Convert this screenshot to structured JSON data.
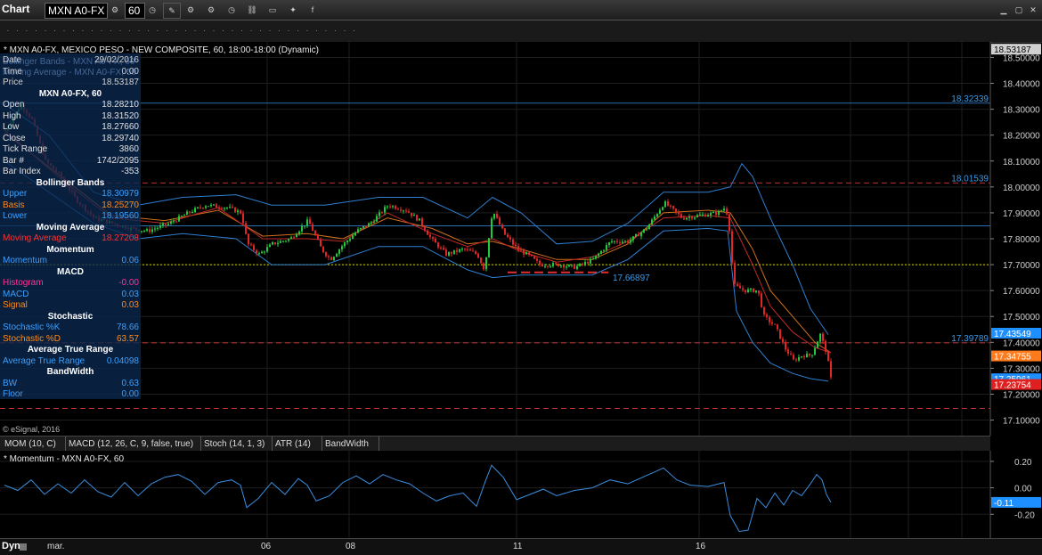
{
  "toolbar": {
    "app_title": "Chart",
    "symbol": "MXN A0-FX",
    "interval": "60",
    "icons": [
      "settings-icon",
      "clock-icon",
      "pencil-icon",
      "gear-icon",
      "gear-icon",
      "clock-icon",
      "link-icon",
      "display-icon",
      "twitter-icon",
      "facebook-icon"
    ]
  },
  "chart_header": "* MXN A0-FX, MEXICO PESO - NEW COMPOSITE, 60, 18:00-18:00 (Dynamic)",
  "copyright": "© eSignal, 2016",
  "info_panel": {
    "top_rows": [
      {
        "label": "Date",
        "value": "29/02/2016"
      },
      {
        "label": "Time",
        "value": "0:00"
      },
      {
        "label": "Price",
        "value": "18.53187"
      }
    ],
    "ghost_rows": [
      "Bollinger Bands - MXN A0-FX, 60",
      "Moving Average - MXN A0-FX, 60"
    ],
    "sections": [
      {
        "title": "MXN A0-FX, 60",
        "rows": [
          {
            "label": "Open",
            "value": "18.28210",
            "color": "#e0e0e0"
          },
          {
            "label": "High",
            "value": "18.31520",
            "color": "#e0e0e0"
          },
          {
            "label": "Low",
            "value": "18.27660",
            "color": "#e0e0e0"
          },
          {
            "label": "Close",
            "value": "18.29740",
            "color": "#e0e0e0"
          },
          {
            "label": "Tick Range",
            "value": "3860",
            "color": "#e0e0e0"
          },
          {
            "label": "Bar #",
            "value": "1742/2095",
            "color": "#e0e0e0"
          },
          {
            "label": "Bar Index",
            "value": "-353",
            "color": "#e0e0e0"
          }
        ]
      },
      {
        "title": "Bollinger Bands",
        "rows": [
          {
            "label": "Upper",
            "value": "18.30979",
            "color": "#3aa0ff"
          },
          {
            "label": "Basis",
            "value": "18.25270",
            "color": "#ff8c1a"
          },
          {
            "label": "Lower",
            "value": "18.19560",
            "color": "#3aa0ff"
          }
        ]
      },
      {
        "title": "Moving Average",
        "rows": [
          {
            "label": "Moving Average",
            "value": "18.27208",
            "color": "#ff3030"
          }
        ]
      },
      {
        "title": "Momentum",
        "rows": [
          {
            "label": "Momentum",
            "value": "0.06",
            "color": "#3aa0ff"
          }
        ]
      },
      {
        "title": "MACD",
        "rows": [
          {
            "label": "Histogram",
            "value": "-0.00",
            "color": "#ff3399"
          },
          {
            "label": "MACD",
            "value": "0.03",
            "color": "#3aa0ff"
          },
          {
            "label": "Signal",
            "value": "0.03",
            "color": "#ff8c1a"
          }
        ]
      },
      {
        "title": "Stochastic",
        "rows": [
          {
            "label": "Stochastic %K",
            "value": "78.66",
            "color": "#3aa0ff"
          },
          {
            "label": "Stochastic %D",
            "value": "63.57",
            "color": "#ff8c1a"
          }
        ]
      },
      {
        "title": "Average True Range",
        "rows": [
          {
            "label": "Average True Range",
            "value": "0.04098",
            "color": "#3aa0ff"
          }
        ]
      },
      {
        "title": "BandWidth",
        "rows": [
          {
            "label": "BW",
            "value": "0.63",
            "color": "#3aa0ff"
          },
          {
            "label": "Floor",
            "value": "0.00",
            "color": "#3aa0ff"
          }
        ]
      }
    ]
  },
  "indicator_tabs": [
    "MOM (10, C)",
    "MACD (12, 26, C, 9, false, true)",
    "Stoch (14, 1, 3)",
    "ATR (14)",
    "BandWidth"
  ],
  "momentum_header": "* Momentum - MXN A0-FX, 60",
  "bottom_bar": {
    "mode": "Dyn",
    "first_label": "mar."
  },
  "chart_data": [
    {
      "type": "candlestick",
      "title": "MXN A0-FX, MEXICO PESO - NEW COMPOSITE, 60, 18:00-18:00 (Dynamic)",
      "ylim": [
        17.04,
        18.56
      ],
      "y_ticks": [
        "18.50000",
        "18.40000",
        "18.30000",
        "18.20000",
        "18.10000",
        "18.00000",
        "17.90000",
        "17.80000",
        "17.70000",
        "17.60000",
        "17.50000",
        "17.40000",
        "17.30000",
        "17.20000",
        "17.10000"
      ],
      "x_tick_labels": [
        "06",
        "08",
        "11",
        "16"
      ],
      "grid": true,
      "legend": "none",
      "close_path": [
        [
          0,
          18.22
        ],
        [
          18,
          18.32
        ],
        [
          30,
          18.26
        ],
        [
          45,
          18.1
        ],
        [
          60,
          18.05
        ],
        [
          80,
          17.95
        ],
        [
          100,
          17.88
        ],
        [
          120,
          17.86
        ],
        [
          140,
          17.84
        ],
        [
          160,
          17.83
        ],
        [
          185,
          17.86
        ],
        [
          205,
          17.9
        ],
        [
          225,
          17.93
        ],
        [
          250,
          17.92
        ],
        [
          265,
          17.9
        ],
        [
          272,
          17.78
        ],
        [
          285,
          17.74
        ],
        [
          300,
          17.78
        ],
        [
          320,
          17.8
        ],
        [
          340,
          17.87
        ],
        [
          355,
          17.76
        ],
        [
          365,
          17.72
        ],
        [
          380,
          17.78
        ],
        [
          395,
          17.83
        ],
        [
          410,
          17.86
        ],
        [
          430,
          17.93
        ],
        [
          450,
          17.91
        ],
        [
          465,
          17.87
        ],
        [
          478,
          17.8
        ],
        [
          495,
          17.74
        ],
        [
          515,
          17.76
        ],
        [
          530,
          17.74
        ],
        [
          538,
          17.68
        ],
        [
          547,
          17.91
        ],
        [
          560,
          17.82
        ],
        [
          575,
          17.76
        ],
        [
          590,
          17.73
        ],
        [
          600,
          17.7
        ],
        [
          620,
          17.7
        ],
        [
          640,
          17.69
        ],
        [
          660,
          17.72
        ],
        [
          680,
          17.79
        ],
        [
          700,
          17.79
        ],
        [
          720,
          17.84
        ],
        [
          740,
          17.94
        ],
        [
          760,
          17.88
        ],
        [
          780,
          17.89
        ],
        [
          800,
          17.9
        ],
        [
          808,
          17.92
        ],
        [
          812,
          17.88
        ],
        [
          818,
          17.62
        ],
        [
          830,
          17.6
        ],
        [
          845,
          17.6
        ],
        [
          852,
          17.5
        ],
        [
          865,
          17.46
        ],
        [
          875,
          17.38
        ],
        [
          885,
          17.33
        ],
        [
          895,
          17.35
        ],
        [
          905,
          17.35
        ],
        [
          915,
          17.43
        ],
        [
          922,
          17.36
        ],
        [
          928,
          17.24
        ]
      ],
      "bollinger_upper_path": [
        [
          0,
          18.32
        ],
        [
          50,
          18.2
        ],
        [
          100,
          17.98
        ],
        [
          150,
          17.93
        ],
        [
          200,
          17.96
        ],
        [
          260,
          17.97
        ],
        [
          300,
          17.93
        ],
        [
          360,
          17.93
        ],
        [
          420,
          17.96
        ],
        [
          470,
          17.96
        ],
        [
          520,
          17.88
        ],
        [
          548,
          17.96
        ],
        [
          580,
          17.9
        ],
        [
          620,
          17.78
        ],
        [
          660,
          17.79
        ],
        [
          700,
          17.86
        ],
        [
          740,
          17.98
        ],
        [
          790,
          17.98
        ],
        [
          815,
          18.0
        ],
        [
          828,
          18.09
        ],
        [
          840,
          18.04
        ],
        [
          860,
          17.88
        ],
        [
          885,
          17.7
        ],
        [
          905,
          17.53
        ],
        [
          925,
          17.43
        ]
      ],
      "bollinger_lower_path": [
        [
          0,
          18.1
        ],
        [
          50,
          17.98
        ],
        [
          100,
          17.86
        ],
        [
          150,
          17.8
        ],
        [
          200,
          17.82
        ],
        [
          260,
          17.8
        ],
        [
          300,
          17.7
        ],
        [
          360,
          17.7
        ],
        [
          420,
          17.77
        ],
        [
          470,
          17.77
        ],
        [
          520,
          17.68
        ],
        [
          548,
          17.65
        ],
        [
          580,
          17.66
        ],
        [
          620,
          17.66
        ],
        [
          660,
          17.66
        ],
        [
          700,
          17.72
        ],
        [
          740,
          17.83
        ],
        [
          790,
          17.84
        ],
        [
          812,
          17.83
        ],
        [
          822,
          17.52
        ],
        [
          840,
          17.4
        ],
        [
          860,
          17.32
        ],
        [
          885,
          17.28
        ],
        [
          905,
          17.26
        ],
        [
          925,
          17.25
        ]
      ],
      "moving_average_path": [
        [
          0,
          18.22
        ],
        [
          60,
          18.04
        ],
        [
          120,
          17.88
        ],
        [
          180,
          17.86
        ],
        [
          240,
          17.92
        ],
        [
          290,
          17.8
        ],
        [
          340,
          17.8
        ],
        [
          380,
          17.79
        ],
        [
          430,
          17.9
        ],
        [
          480,
          17.82
        ],
        [
          520,
          17.77
        ],
        [
          548,
          17.8
        ],
        [
          580,
          17.75
        ],
        [
          620,
          17.71
        ],
        [
          660,
          17.73
        ],
        [
          700,
          17.79
        ],
        [
          740,
          17.88
        ],
        [
          790,
          17.89
        ],
        [
          815,
          17.88
        ],
        [
          840,
          17.7
        ],
        [
          860,
          17.54
        ],
        [
          885,
          17.44
        ],
        [
          910,
          17.38
        ],
        [
          928,
          17.36
        ]
      ],
      "bollinger_basis_path": [
        [
          0,
          18.21
        ],
        [
          60,
          18.05
        ],
        [
          120,
          17.89
        ],
        [
          180,
          17.87
        ],
        [
          240,
          17.91
        ],
        [
          290,
          17.81
        ],
        [
          340,
          17.82
        ],
        [
          380,
          17.8
        ],
        [
          430,
          17.88
        ],
        [
          480,
          17.84
        ],
        [
          520,
          17.78
        ],
        [
          548,
          17.79
        ],
        [
          580,
          17.76
        ],
        [
          620,
          17.72
        ],
        [
          660,
          17.72
        ],
        [
          700,
          17.78
        ],
        [
          740,
          17.9
        ],
        [
          790,
          17.91
        ],
        [
          815,
          17.9
        ],
        [
          840,
          17.76
        ],
        [
          860,
          17.6
        ],
        [
          885,
          17.5
        ],
        [
          910,
          17.4
        ],
        [
          928,
          17.36
        ]
      ],
      "horizontal_lines": [
        {
          "value": 18.32339,
          "label": "18.32339",
          "style": "solid",
          "color": "#2a6fb0"
        },
        {
          "value": 18.01539,
          "label": "18.01539",
          "style": "dashed",
          "color": "#c03030"
        },
        {
          "value": 17.85,
          "label": "",
          "style": "solid",
          "color": "#2a6fb0"
        },
        {
          "value": 17.7,
          "label": "",
          "style": "dotted",
          "color": "#d8d800"
        },
        {
          "value": 17.39789,
          "label": "17.39789",
          "style": "dashed",
          "color": "#c03030"
        },
        {
          "value": 17.145,
          "label": "",
          "style": "dashed",
          "color": "#c03030"
        }
      ],
      "support_segment": {
        "from": 565,
        "to": 678,
        "value": 17.67,
        "label": "17.66897"
      },
      "price_tags": [
        {
          "value": 18.53187,
          "label": "18.53187",
          "bg": "#d0d0d0",
          "fg": "#000"
        },
        {
          "value": 17.43549,
          "label": "17.43549",
          "bg": "#1e8fff",
          "fg": "#fff"
        },
        {
          "value": 17.34755,
          "label": "17.34755",
          "bg": "#ff7a1a",
          "fg": "#fff"
        },
        {
          "value": 17.25961,
          "label": "17.25961",
          "bg": "#1e8fff",
          "fg": "#fff"
        },
        {
          "value": 17.23754,
          "label": "17.23754",
          "bg": "#e02020",
          "fg": "#fff"
        }
      ]
    },
    {
      "type": "line",
      "title": "* Momentum - MXN A0-FX, 60",
      "ylim": [
        -0.38,
        0.28
      ],
      "y_ticks": [
        "0.20",
        "0.00",
        "-0.20"
      ],
      "last_value": {
        "value": -0.11,
        "label": "-0.11"
      },
      "series": [
        {
          "color": "#3a8ee0",
          "values": [
            [
              0,
              0.02
            ],
            [
              15,
              -0.02
            ],
            [
              30,
              0.06
            ],
            [
              45,
              -0.05
            ],
            [
              60,
              0.03
            ],
            [
              75,
              -0.04
            ],
            [
              90,
              0.06
            ],
            [
              105,
              -0.03
            ],
            [
              120,
              -0.07
            ],
            [
              135,
              0.04
            ],
            [
              150,
              -0.06
            ],
            [
              165,
              0.03
            ],
            [
              180,
              0.08
            ],
            [
              195,
              0.1
            ],
            [
              210,
              0.05
            ],
            [
              225,
              -0.05
            ],
            [
              240,
              0.04
            ],
            [
              255,
              0.06
            ],
            [
              265,
              0.02
            ],
            [
              272,
              -0.15
            ],
            [
              285,
              -0.08
            ],
            [
              300,
              0.04
            ],
            [
              315,
              -0.05
            ],
            [
              330,
              0.07
            ],
            [
              340,
              0.02
            ],
            [
              350,
              -0.1
            ],
            [
              365,
              -0.06
            ],
            [
              380,
              0.04
            ],
            [
              395,
              0.09
            ],
            [
              410,
              0.03
            ],
            [
              425,
              0.1
            ],
            [
              440,
              0.06
            ],
            [
              455,
              0.03
            ],
            [
              470,
              -0.04
            ],
            [
              485,
              -0.1
            ],
            [
              500,
              -0.06
            ],
            [
              515,
              -0.04
            ],
            [
              530,
              -0.14
            ],
            [
              540,
              0.05
            ],
            [
              547,
              0.17
            ],
            [
              560,
              0.08
            ],
            [
              575,
              -0.09
            ],
            [
              590,
              -0.05
            ],
            [
              605,
              -0.01
            ],
            [
              620,
              -0.06
            ],
            [
              640,
              -0.02
            ],
            [
              660,
              0.0
            ],
            [
              680,
              0.06
            ],
            [
              700,
              0.03
            ],
            [
              720,
              0.09
            ],
            [
              740,
              0.15
            ],
            [
              755,
              0.06
            ],
            [
              770,
              0.02
            ],
            [
              790,
              0.01
            ],
            [
              808,
              0.04
            ],
            [
              815,
              -0.21
            ],
            [
              825,
              -0.33
            ],
            [
              835,
              -0.32
            ],
            [
              845,
              -0.08
            ],
            [
              855,
              -0.15
            ],
            [
              865,
              -0.04
            ],
            [
              875,
              -0.13
            ],
            [
              885,
              -0.02
            ],
            [
              895,
              -0.06
            ],
            [
              905,
              0.03
            ],
            [
              912,
              0.1
            ],
            [
              918,
              0.06
            ],
            [
              923,
              -0.05
            ],
            [
              928,
              -0.11
            ]
          ]
        }
      ]
    }
  ]
}
